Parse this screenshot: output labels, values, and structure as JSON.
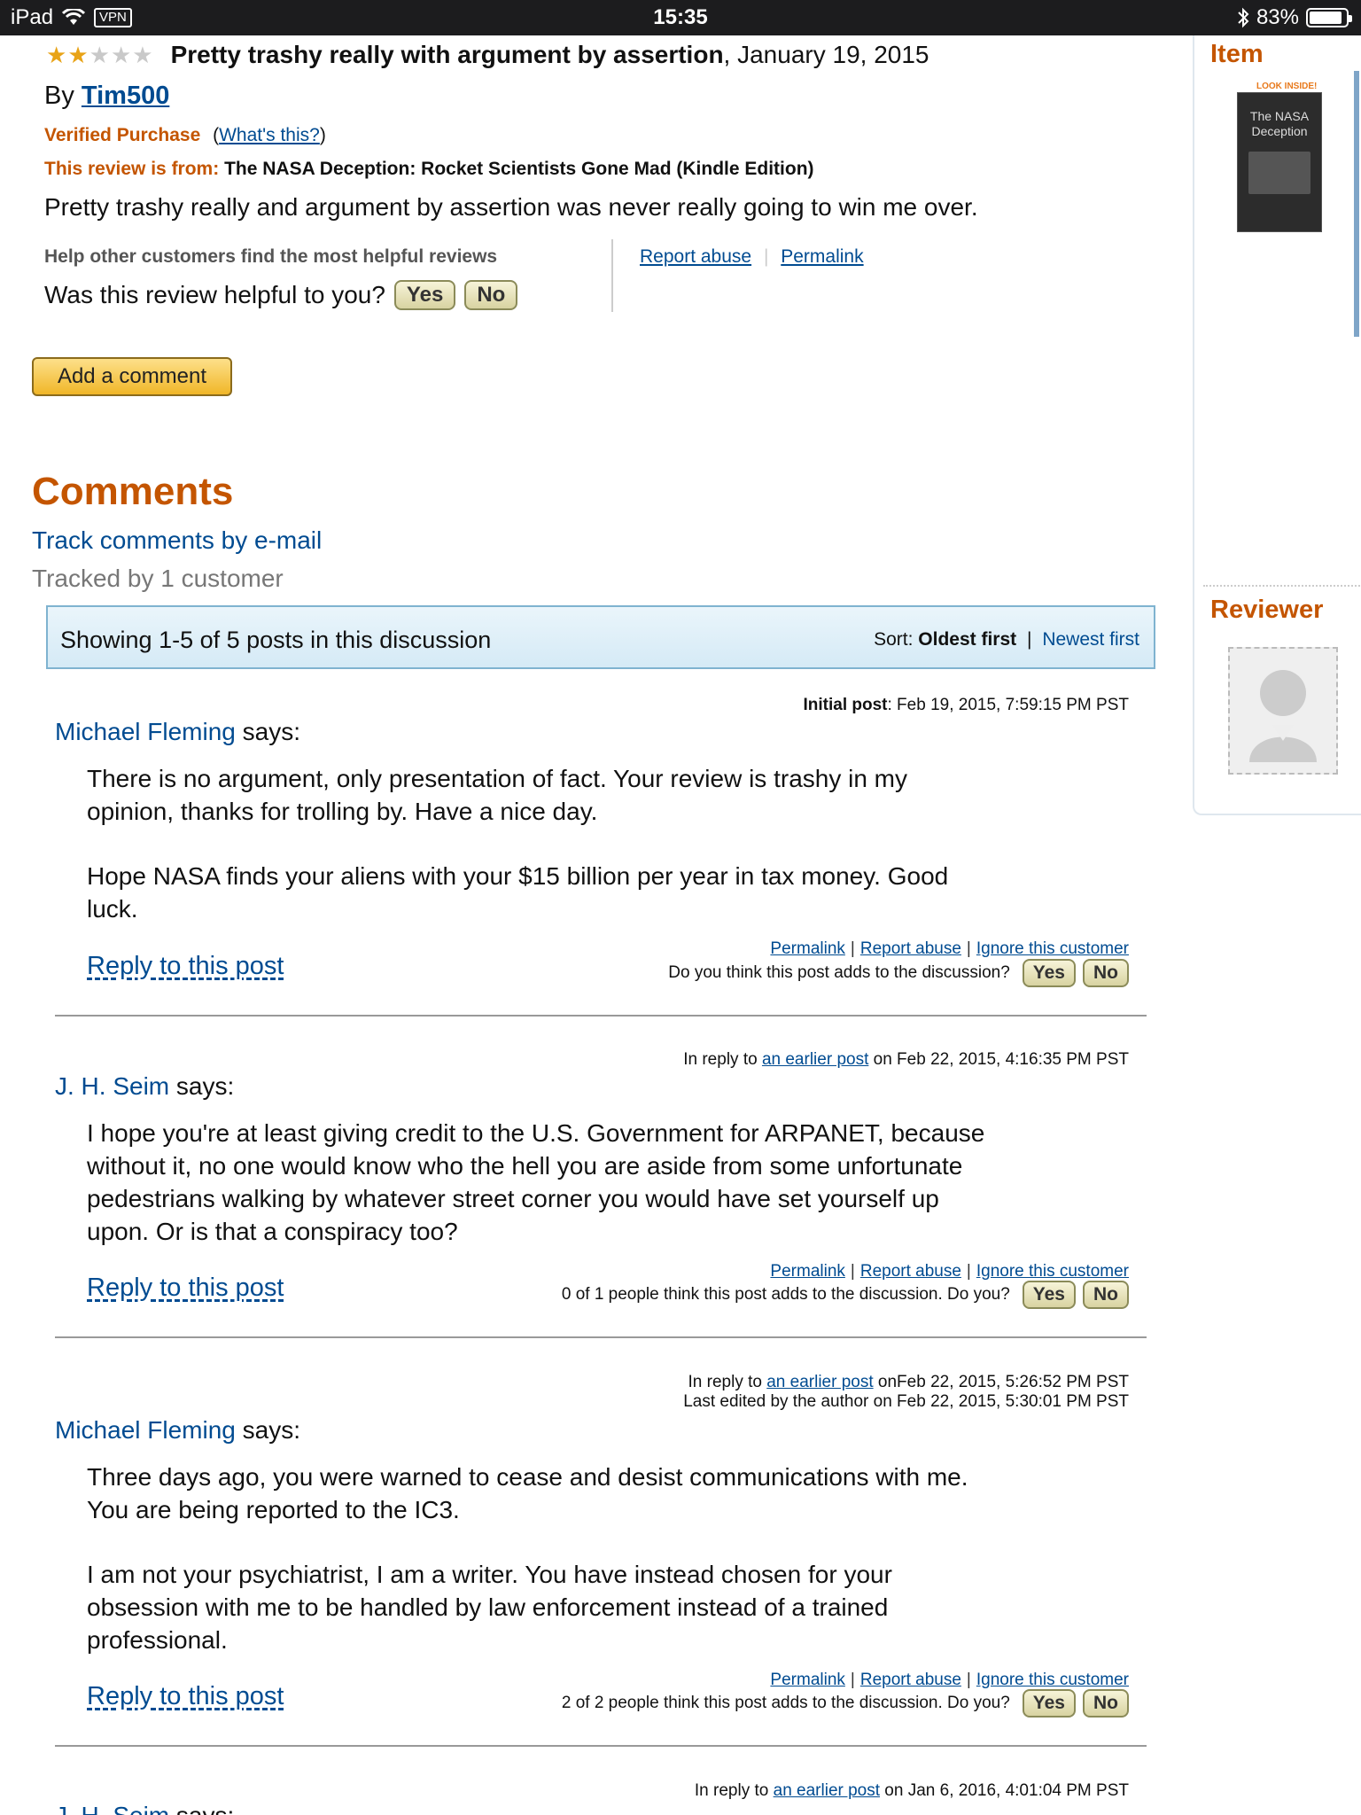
{
  "status_bar": {
    "device": "iPad",
    "vpn": "VPN",
    "time": "15:35",
    "battery": "83%"
  },
  "review": {
    "rating": 2,
    "rating_max": 5,
    "title": "Pretty trashy really with argument by assertion",
    "date": ", January 19, 2015",
    "by_label": "By",
    "author": "Tim500",
    "verified": "Verified Purchase",
    "whats_this": "What's this?",
    "from_label": "This review is from:",
    "from_product": "The NASA Deception: Rocket Scientists Gone Mad (Kindle Edition)",
    "text": "Pretty trashy really and argument by assertion was never really going to win me over.",
    "help_label": "Help other customers find the most helpful reviews",
    "helpful_q": "Was this review helpful to you?",
    "yes": "Yes",
    "no": "No",
    "report_abuse": "Report abuse",
    "permalink": "Permalink"
  },
  "add_comment": "Add a comment",
  "comments": {
    "heading": "Comments",
    "track": "Track comments by e-mail",
    "tracked_by": "Tracked by 1 customer",
    "showing": "Showing 1-5 of 5 posts in this discussion",
    "sort_label": "Sort:",
    "sort_active": "Oldest first",
    "sort_other": "Newest first"
  },
  "posts": [
    {
      "meta_bold": "Initial post",
      "meta": ": Feb 19, 2015, 7:59:15 PM PST",
      "author": "Michael Fleming",
      "says": " says:",
      "para1": "There is no argument, only presentation of fact. Your review is trashy in my opinion, thanks for trolling by. Have a nice day.",
      "para2": "Hope NASA finds your aliens with your $15 billion per year in tax money. Good luck.",
      "reply": "Reply to this post",
      "permalink": "Permalink",
      "report": "Report abuse",
      "ignore": "Ignore this customer",
      "question": "Do you think this post adds to the discussion?",
      "yes": "Yes",
      "no": "No"
    },
    {
      "meta_pre": "In reply to ",
      "meta_link": "an earlier post",
      "meta": " on Feb 22, 2015, 4:16:35 PM PST",
      "author": "J. H. Seim",
      "says": " says:",
      "para1": "I hope you're at least giving credit to the U.S. Government for ARPANET, because without it, no one would know who the hell you are aside from some unfortunate pedestrians walking by whatever street corner you would have set yourself up upon. Or is that a conspiracy too?",
      "reply": "Reply to this post",
      "permalink": "Permalink",
      "report": "Report abuse",
      "ignore": "Ignore this customer",
      "question": "0 of 1 people think this post adds to the discussion. Do you?",
      "yes": "Yes",
      "no": "No"
    },
    {
      "meta_pre": "In reply to ",
      "meta_link": "an earlier post",
      "meta": " onFeb 22, 2015, 5:26:52 PM PST",
      "meta2": "Last edited by the author on Feb 22, 2015, 5:30:01 PM PST",
      "author": "Michael Fleming",
      "says": " says:",
      "para1": "Three days ago, you were warned to cease and desist communications with me. You are being reported to the IC3.",
      "para2": "I am not your psychiatrist, I am a writer. You have instead chosen for your obsession with me to be handled by law enforcement instead of a trained professional.",
      "reply": "Reply to this post",
      "permalink": "Permalink",
      "report": "Report abuse",
      "ignore": "Ignore this customer",
      "question": "2 of 2 people think this post adds to the discussion. Do you?",
      "yes": "Yes",
      "no": "No"
    },
    {
      "meta_pre": "In reply to ",
      "meta_link": "an earlier post",
      "meta": " on Jan 6, 2016, 4:01:04 PM PST",
      "author": "J. H. Seim",
      "says": " says:"
    }
  ],
  "sidebar": {
    "item_heading": "Item",
    "look_inside": "LOOK INSIDE!",
    "book_title": "The NASA Deception",
    "reviewer_heading": "Reviewer"
  },
  "colors": {
    "accent_orange": "#c45500",
    "link_blue": "#004b91",
    "star": "#e8a317"
  }
}
